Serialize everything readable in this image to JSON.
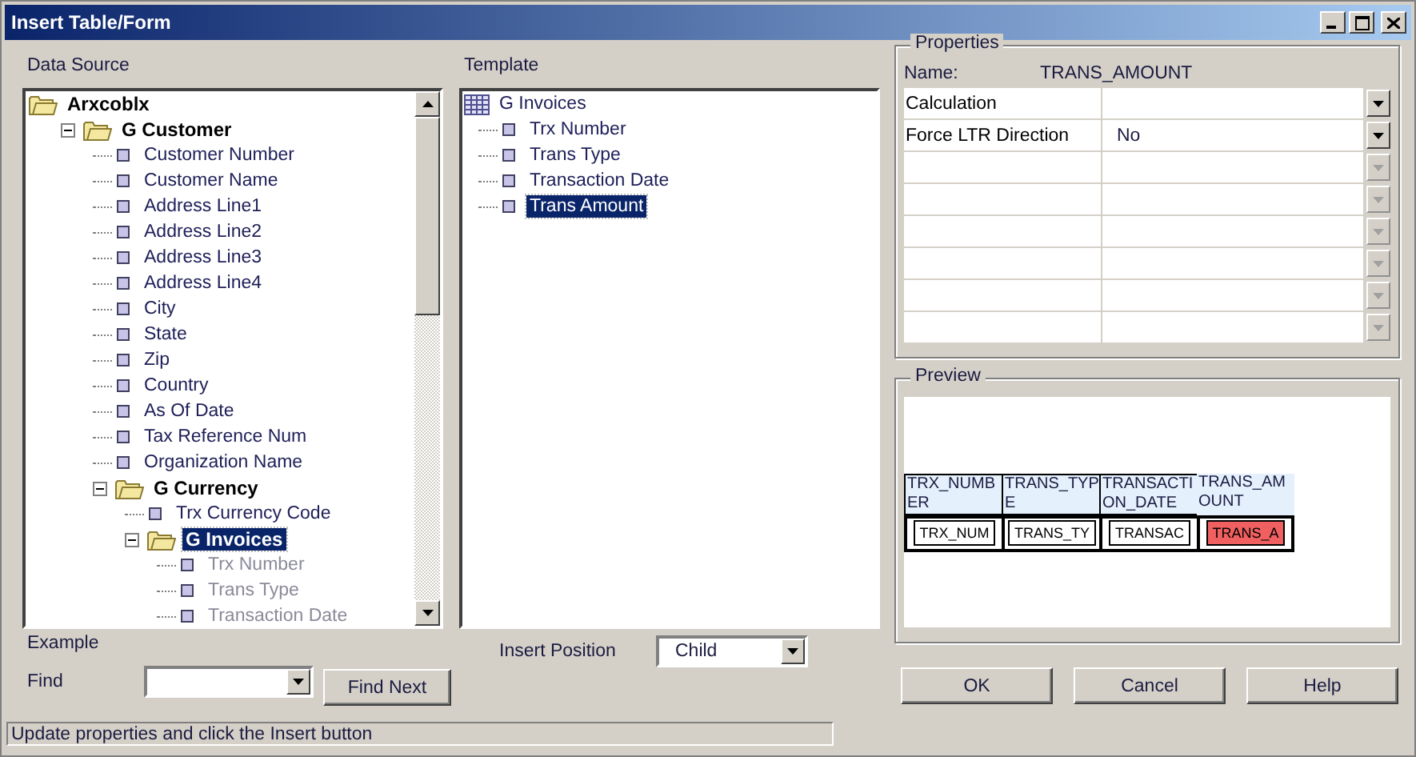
{
  "window": {
    "title": "Insert Table/Form"
  },
  "data_source": {
    "label": "Data Source",
    "items": [
      {
        "label": "Arxcoblx",
        "kind": "folder",
        "selected": false,
        "children": [
          {
            "label": "G Customer",
            "kind": "folder",
            "expanded": true,
            "selected": false,
            "children": [
              {
                "label": "Customer Number",
                "kind": "field",
                "selected": false,
                "disabled": false
              },
              {
                "label": "Customer Name",
                "kind": "field",
                "selected": false,
                "disabled": false
              },
              {
                "label": "Address Line1",
                "kind": "field",
                "selected": false,
                "disabled": false
              },
              {
                "label": "Address Line2",
                "kind": "field",
                "selected": false,
                "disabled": false
              },
              {
                "label": "Address Line3",
                "kind": "field",
                "selected": false,
                "disabled": false
              },
              {
                "label": "Address Line4",
                "kind": "field",
                "selected": false,
                "disabled": false
              },
              {
                "label": "City",
                "kind": "field",
                "selected": false,
                "disabled": false
              },
              {
                "label": "State",
                "kind": "field",
                "selected": false,
                "disabled": false
              },
              {
                "label": "Zip",
                "kind": "field",
                "selected": false,
                "disabled": false
              },
              {
                "label": "Country",
                "kind": "field",
                "selected": false,
                "disabled": false
              },
              {
                "label": "As Of Date",
                "kind": "field",
                "selected": false,
                "disabled": false
              },
              {
                "label": "Tax Reference Num",
                "kind": "field",
                "selected": false,
                "disabled": false
              },
              {
                "label": "Organization Name",
                "kind": "field",
                "selected": false,
                "disabled": false
              },
              {
                "label": "G Currency",
                "kind": "folder",
                "expanded": true,
                "selected": false,
                "children": [
                  {
                    "label": "Trx Currency Code",
                    "kind": "field",
                    "selected": false,
                    "disabled": false
                  },
                  {
                    "label": "G Invoices",
                    "kind": "folder",
                    "expanded": true,
                    "selected": true,
                    "children": [
                      {
                        "label": "Trx Number",
                        "kind": "field",
                        "selected": false,
                        "disabled": true
                      },
                      {
                        "label": "Trans Type",
                        "kind": "field",
                        "selected": false,
                        "disabled": true
                      },
                      {
                        "label": "Transaction Date",
                        "kind": "field",
                        "selected": false,
                        "disabled": true
                      }
                    ]
                  }
                ]
              }
            ]
          }
        ]
      }
    ]
  },
  "template": {
    "label": "Template",
    "items": [
      {
        "label": "G Invoices",
        "kind": "table",
        "selected": false,
        "children": [
          {
            "label": "Trx Number",
            "kind": "field",
            "selected": false
          },
          {
            "label": "Trans Type",
            "kind": "field",
            "selected": false
          },
          {
            "label": "Transaction Date",
            "kind": "field",
            "selected": false
          },
          {
            "label": "Trans Amount",
            "kind": "field",
            "selected": true
          }
        ]
      }
    ]
  },
  "properties": {
    "title": "Properties",
    "name_label": "Name:",
    "name_value": "TRANS_AMOUNT",
    "rows": [
      {
        "label": "Calculation",
        "disabled": false
      },
      {
        "label": "Force LTR Direction",
        "value": "No",
        "disabled": false
      },
      {
        "disabled": true
      },
      {
        "disabled": true
      },
      {
        "disabled": true
      },
      {
        "disabled": true
      },
      {
        "disabled": true
      },
      {
        "disabled": true
      }
    ]
  },
  "preview": {
    "title": "Preview",
    "columns": [
      {
        "header": "TRX_NUMBER",
        "field": "TRX_NUM",
        "selected": false
      },
      {
        "header": "TRANS_TYPE",
        "field": "TRANS_TY",
        "selected": false
      },
      {
        "header": "TRANSACTION_DATE",
        "field": "TRANSAC",
        "selected": false
      },
      {
        "header": "TRANS_AMOUNT",
        "field": "TRANS_A",
        "selected": true
      }
    ]
  },
  "example_label": "Example",
  "find": {
    "label": "Find",
    "button": "Find Next"
  },
  "insert_position": {
    "label": "Insert Position",
    "value": "Child"
  },
  "buttons": [
    "OK",
    "Cancel",
    "Help"
  ],
  "status_bar": "Update properties and click the Insert button"
}
